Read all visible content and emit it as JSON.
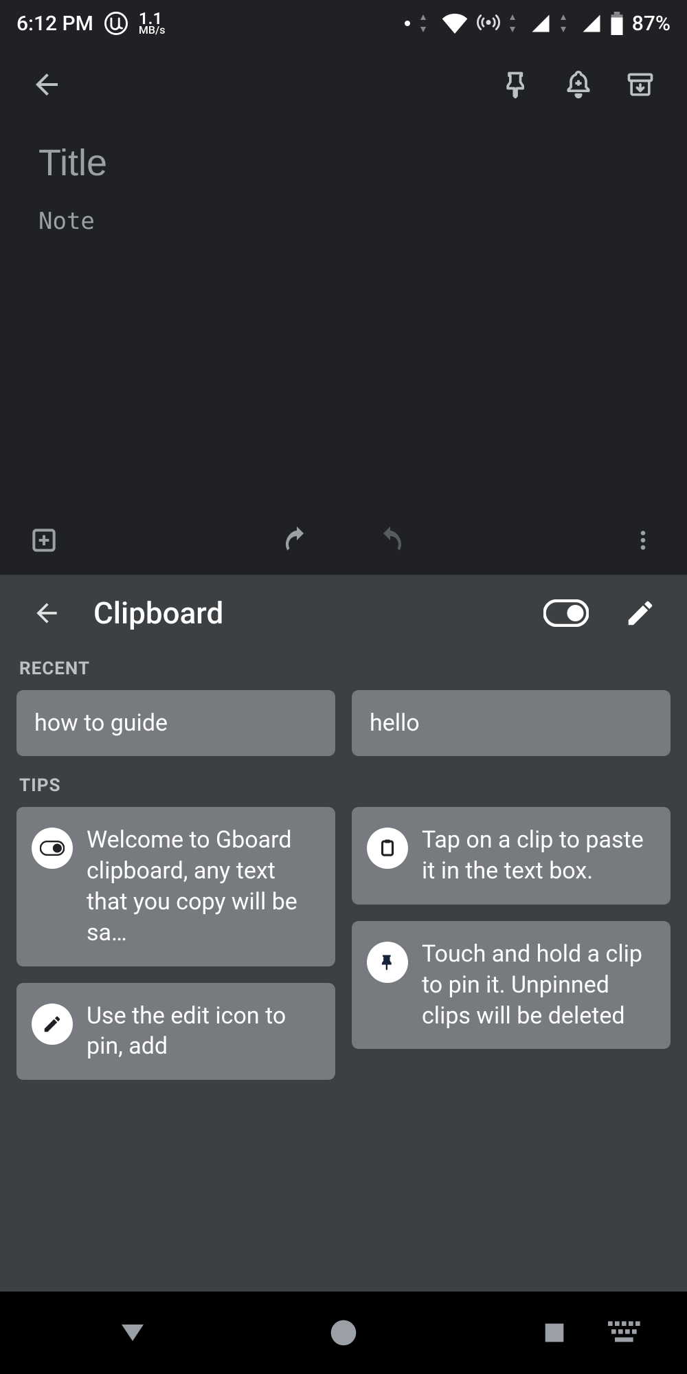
{
  "status": {
    "time": "6:12 PM",
    "netspeed_value": "1.1",
    "netspeed_unit": "MB/s",
    "battery_pct": "87%"
  },
  "appbar": {},
  "note": {
    "title_placeholder": "Title",
    "note_placeholder": "Note",
    "title_value": "",
    "note_value": ""
  },
  "clipboard": {
    "title": "Clipboard",
    "recent_label": "RECENT",
    "tips_label": "TIPS",
    "recent": [
      {
        "text": "how to guide"
      },
      {
        "text": "hello"
      }
    ],
    "tips": [
      {
        "icon": "toggle",
        "text": "Welcome to Gboard clipboard, any text that you copy will be sa…"
      },
      {
        "icon": "clipboard",
        "text": "Tap on a clip to paste it in the text box."
      },
      {
        "icon": "pencil",
        "text": "Use the edit icon to pin, add"
      },
      {
        "icon": "pin",
        "text": "Touch and hold a clip to pin it. Unpinned clips will be deleted"
      }
    ]
  }
}
